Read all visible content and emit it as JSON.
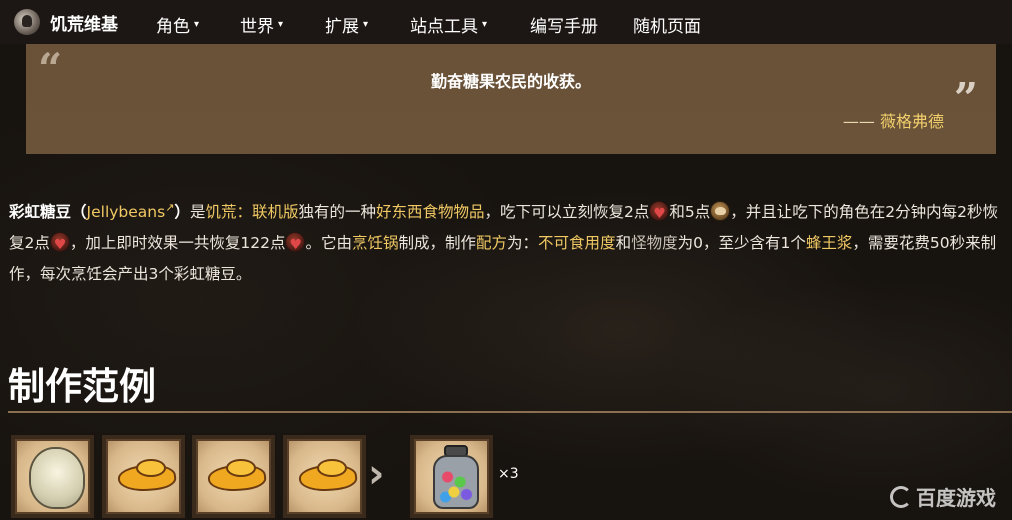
{
  "nav": {
    "site_name": "饥荒维基",
    "items": [
      {
        "label": "角色",
        "dropdown": true
      },
      {
        "label": "世界",
        "dropdown": true
      },
      {
        "label": "扩展",
        "dropdown": true
      },
      {
        "label": "站点工具",
        "dropdown": true
      },
      {
        "label": "编写手册",
        "dropdown": false
      },
      {
        "label": "随机页面",
        "dropdown": false
      }
    ],
    "caret": "▾"
  },
  "quote": {
    "open_mark": "“",
    "close_mark": "”",
    "text": "勤奋糖果农民的收获。",
    "author_prefix": "—— ",
    "author": "薇格弗德"
  },
  "paragraph": {
    "item_name": "彩虹糖豆",
    "paren_open": "（",
    "english_name": "Jellybeans",
    "ext_icon": "↗",
    "paren_close": "）",
    "t1": "是",
    "link_game": "饥荒：联机版",
    "t2": "独有的一种",
    "link_good": "好东西",
    "link_food": "食物",
    "link_item": "物品",
    "t3": "，吃下可以立刻恢复2点",
    "t4": "和5点",
    "t5": "，并且让吃下的角色在2分钟内每2秒恢复2点",
    "t6": "，加上即时效果一共恢复122点",
    "t7": "。它由",
    "link_crockpot": "烹饪锅",
    "t8": "制成，制作",
    "link_recipe": "配方",
    "t9": "为：",
    "link_inedible": "不可食用度",
    "t10": "和",
    "link_monster": "怪物度",
    "t11": "为0，至少含有1个",
    "link_royal_jelly": "蜂王浆",
    "t12": "，需要花费50秒来制作，每次烹饪会产出3个彩虹糖豆。",
    "icons": [
      "health-icon",
      "hunger-icon",
      "health-icon",
      "health-icon"
    ]
  },
  "section": {
    "heading": "制作范例"
  },
  "recipe": {
    "ingredients": [
      "glommer-goop-slot",
      "butter-slot",
      "butter-slot",
      "butter-slot"
    ],
    "arrow": "›",
    "result": "jellybeans-slot",
    "count": "×3"
  },
  "watermark": {
    "text": "百度游戏"
  },
  "colors": {
    "nav_bg": "#1c1714",
    "quote_bg": "#6b5339",
    "link": "#f0c964",
    "rule": "#8a7050"
  }
}
